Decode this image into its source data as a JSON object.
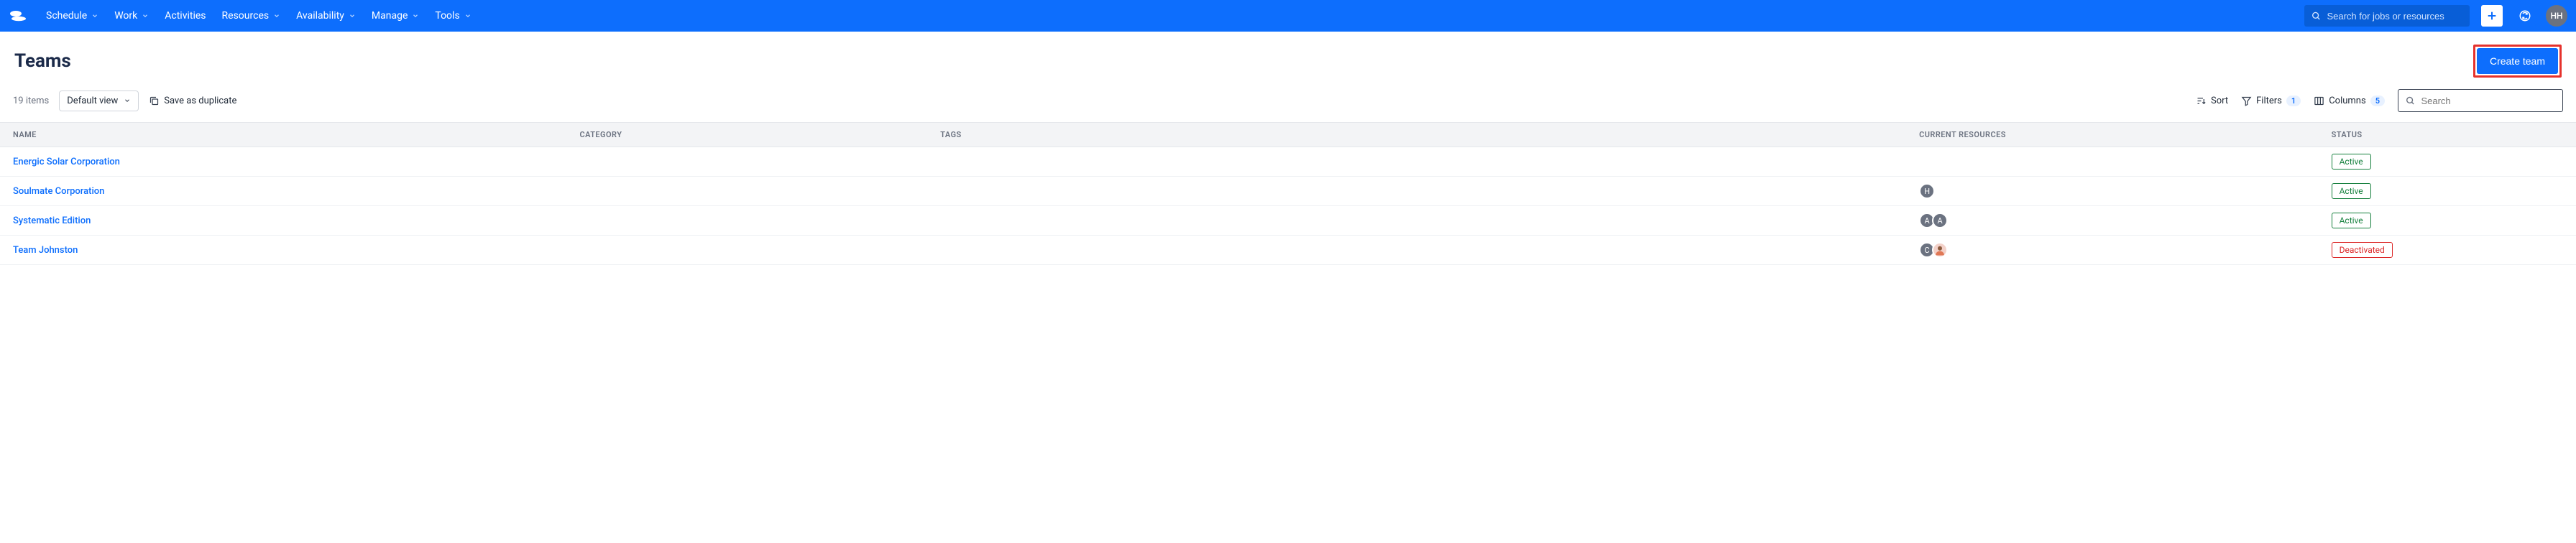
{
  "nav": {
    "items": [
      {
        "label": "Schedule",
        "caret": true
      },
      {
        "label": "Work",
        "caret": true
      },
      {
        "label": "Activities",
        "caret": false
      },
      {
        "label": "Resources",
        "caret": true
      },
      {
        "label": "Availability",
        "caret": true
      },
      {
        "label": "Manage",
        "caret": true
      },
      {
        "label": "Tools",
        "caret": true
      }
    ],
    "search_placeholder": "Search for jobs or resources",
    "user_initials": "HH"
  },
  "page": {
    "title": "Teams",
    "create_label": "Create team"
  },
  "toolbar": {
    "count": "19 items",
    "view_label": "Default view",
    "duplicate_label": "Save as duplicate",
    "sort_label": "Sort",
    "filters_label": "Filters",
    "filters_count": "1",
    "columns_label": "Columns",
    "columns_count": "5",
    "search_placeholder": "Search"
  },
  "table": {
    "headers": {
      "name": "Name",
      "category": "Category",
      "tags": "Tags",
      "resources": "Current Resources",
      "status": "Status"
    },
    "rows": [
      {
        "name": "Energic Solar Corporation",
        "resources": [],
        "status": "Active"
      },
      {
        "name": "Soulmate Corporation",
        "resources": [
          {
            "type": "letter",
            "v": "H"
          }
        ],
        "status": "Active"
      },
      {
        "name": "Systematic Edition",
        "resources": [
          {
            "type": "letter",
            "v": "A"
          },
          {
            "type": "letter",
            "v": "A"
          }
        ],
        "status": "Active"
      },
      {
        "name": "Team Johnston",
        "resources": [
          {
            "type": "letter",
            "v": "C"
          },
          {
            "type": "img",
            "v": ""
          }
        ],
        "status": "Deactivated"
      }
    ]
  }
}
